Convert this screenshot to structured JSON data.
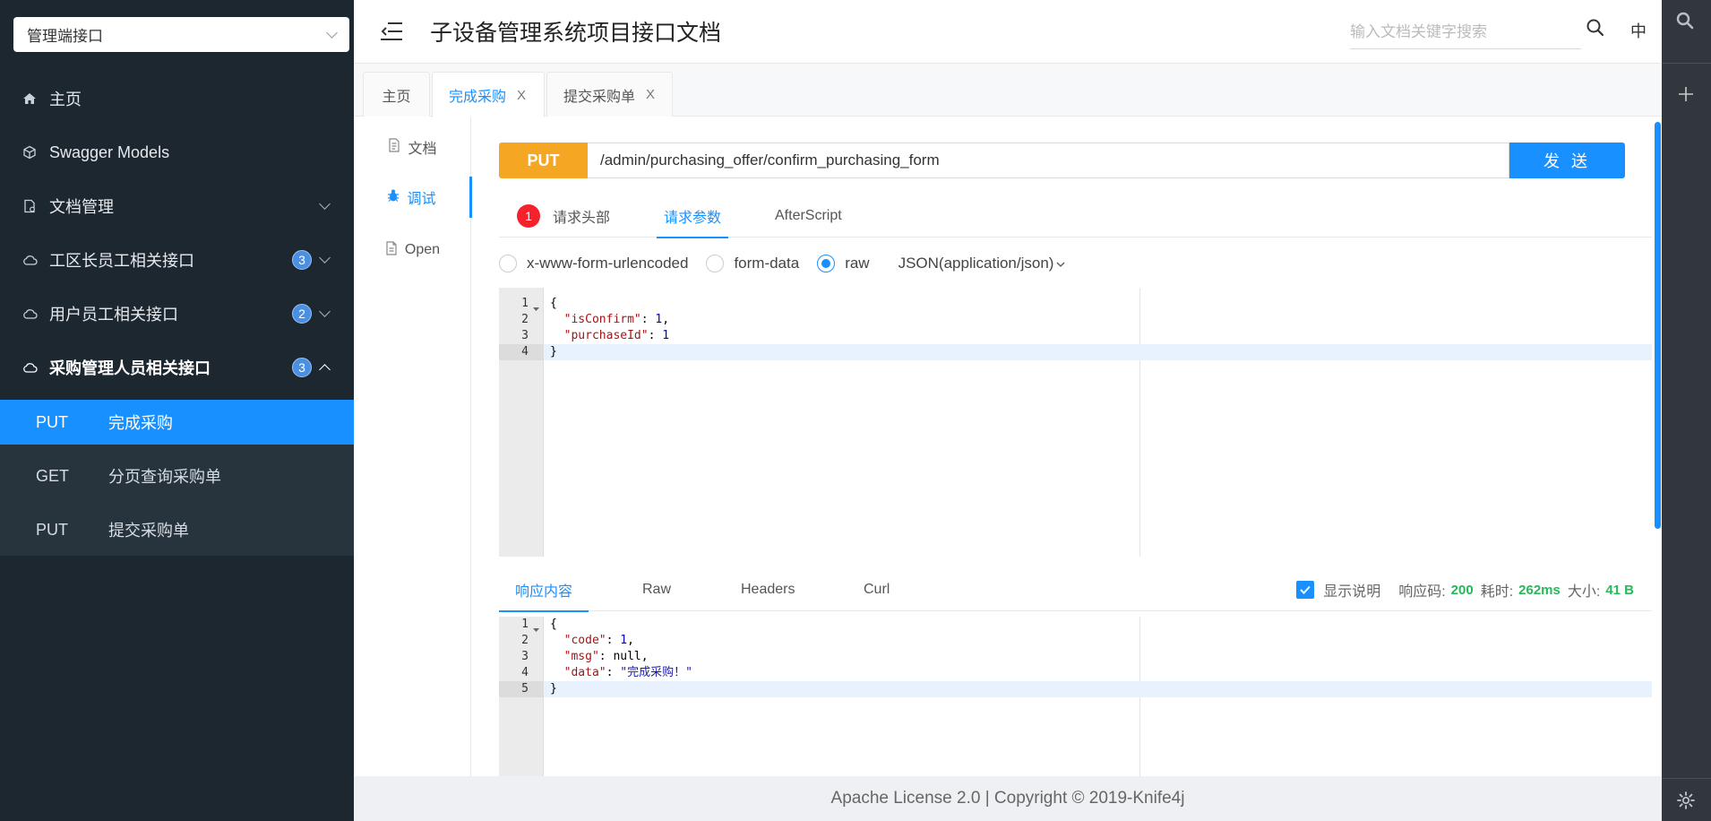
{
  "sidebar": {
    "group_select": "管理端接口",
    "items": [
      {
        "label": "主页"
      },
      {
        "label": "Swagger Models"
      },
      {
        "label": "文档管理"
      },
      {
        "label": "工区长员工相关接口",
        "badge": "3"
      },
      {
        "label": "用户员工相关接口",
        "badge": "2"
      },
      {
        "label": "采购管理人员相关接口",
        "badge": "3"
      }
    ],
    "sub_items": [
      {
        "method": "PUT",
        "label": "完成采购"
      },
      {
        "method": "GET",
        "label": "分页查询采购单"
      },
      {
        "method": "PUT",
        "label": "提交采购单"
      }
    ]
  },
  "header": {
    "title": "子设备管理系统项目接口文档",
    "search_placeholder": "输入文档关键字搜索",
    "lang": "中"
  },
  "tabs": [
    {
      "label": "主页"
    },
    {
      "label": "完成采购",
      "close": "X"
    },
    {
      "label": "提交采购单",
      "close": "X"
    }
  ],
  "doc_menu": [
    {
      "label": "文档"
    },
    {
      "label": "调试"
    },
    {
      "label": "Open"
    }
  ],
  "request": {
    "method": "PUT",
    "url": "/admin/purchasing_offer/confirm_purchasing_form",
    "send_label": "发 送",
    "tabs": [
      {
        "label": "请求头部",
        "badge": "1"
      },
      {
        "label": "请求参数"
      },
      {
        "label": "AfterScript"
      }
    ],
    "body_types": [
      "x-www-form-urlencoded",
      "form-data",
      "raw"
    ],
    "content_type": "JSON(application/json)",
    "body_lines": [
      "1",
      "2",
      "3",
      "4"
    ]
  },
  "response": {
    "tabs": [
      {
        "label": "响应内容"
      },
      {
        "label": "Raw"
      },
      {
        "label": "Headers"
      },
      {
        "label": "Curl"
      }
    ],
    "show_desc_label": "显示说明",
    "code_label": "响应码:",
    "code": "200",
    "time_label": "耗时:",
    "time": "262ms",
    "size_label": "大小:",
    "size": "41 B",
    "body_lines": [
      "1",
      "2",
      "3",
      "4",
      "5"
    ]
  },
  "footer": {
    "text": "Apache License 2.0 | Copyright © 2019-Knife4j"
  },
  "colors": {
    "accent": "#1990ff",
    "put": "#f5a623",
    "sidebar": "#1d2730",
    "success": "#27b85a",
    "error": "#f5222d"
  }
}
